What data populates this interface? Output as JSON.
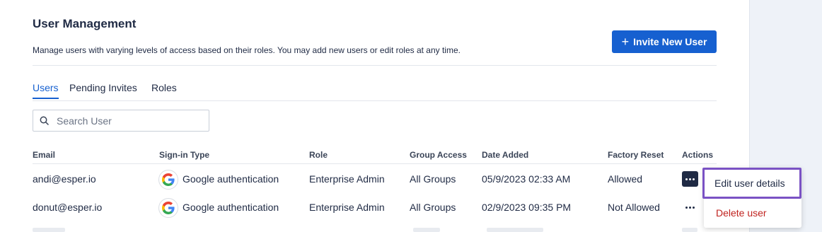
{
  "page": {
    "title": "User Management",
    "subtitle": "Manage users with varying levels of access based on their roles. You may add new users or edit roles at any time.",
    "invite_button": "Invite New User"
  },
  "tabs": [
    {
      "label": "Users",
      "active": true
    },
    {
      "label": "Pending Invites",
      "active": false
    },
    {
      "label": "Roles",
      "active": false
    }
  ],
  "search": {
    "placeholder": "Search User",
    "value": ""
  },
  "table": {
    "headers": [
      "Email",
      "Sign-in Type",
      "Role",
      "Group Access",
      "Date Added",
      "Factory Reset",
      "Actions"
    ],
    "rows": [
      {
        "email": "andi@esper.io",
        "signin": "Google authentication",
        "role": "Enterprise Admin",
        "group": "All Groups",
        "date": "05/9/2023 02:33 AM",
        "reset": "Allowed"
      },
      {
        "email": "donut@esper.io",
        "signin": "Google authentication",
        "role": "Enterprise Admin",
        "group": "All Groups",
        "date": "02/9/2023 09:35 PM",
        "reset": "Not Allowed"
      }
    ]
  },
  "actions_menu": {
    "edit": "Edit user details",
    "delete": "Delete user"
  },
  "colors": {
    "accent": "#1660d0",
    "highlight": "#7a52c4",
    "danger": "#c0231f",
    "text": "#1f2a44"
  },
  "icons": {
    "invite": "plus-icon",
    "search": "search-icon",
    "signin": "google-icon",
    "actions": "more-horizontal-icon"
  }
}
